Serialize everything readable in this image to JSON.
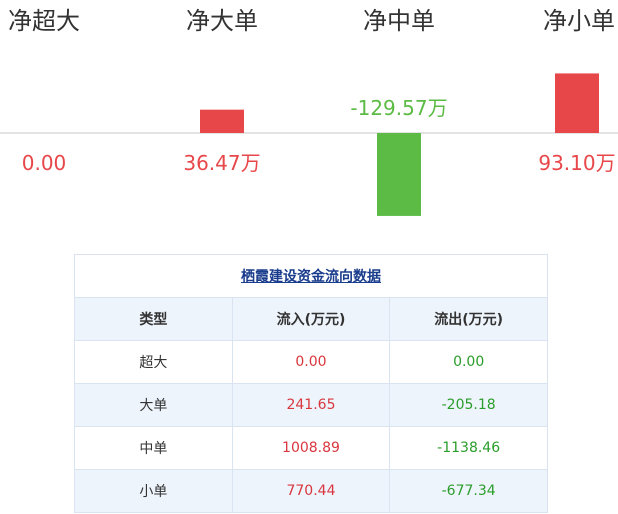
{
  "chart_data": {
    "type": "bar",
    "categories": [
      "净超大",
      "净大单",
      "净中单",
      "净小单"
    ],
    "values": [
      0.0,
      36.47,
      -129.57,
      93.1
    ],
    "value_labels": [
      "0.00",
      "36.47万",
      "-129.57万",
      "93.10万"
    ],
    "colors": {
      "positive": "#e8474a",
      "negative": "#5bbb45",
      "zero": "#e8474a"
    }
  },
  "table": {
    "title": "栖霞建设资金流向数据",
    "headers": [
      "类型",
      "流入(万元)",
      "流出(万元)"
    ],
    "rows": [
      {
        "type": "超大",
        "inflow": "0.00",
        "outflow": "0.00"
      },
      {
        "type": "大单",
        "inflow": "241.65",
        "outflow": "-205.18"
      },
      {
        "type": "中单",
        "inflow": "1008.89",
        "outflow": "-1138.46"
      },
      {
        "type": "小单",
        "inflow": "770.44",
        "outflow": "-677.34"
      }
    ]
  }
}
